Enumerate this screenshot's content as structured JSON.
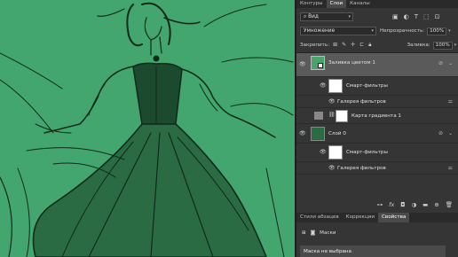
{
  "canvas": {
    "background": "#43a66e",
    "ink": "#0f2a1a"
  },
  "panel": {
    "tabs": [
      "Контуры",
      "Слои",
      "Каналы"
    ],
    "filter": {
      "value": "Вид"
    },
    "blend_mode": "Умножение",
    "opacity_label": "Непрозрачность:",
    "opacity_value": "100%",
    "lock_label": "Закрепить:",
    "fill_label": "Заливка:",
    "fill_value": "100%"
  },
  "layers": [
    {
      "name": "Заливка цветом 1",
      "type": "fill",
      "selected": true,
      "color": "#48a46c"
    },
    {
      "name": "Смарт-фильтры",
      "type": "smart-filters"
    },
    {
      "name": "Галерея фильтров",
      "type": "filter"
    },
    {
      "name": "Карта градиента 1",
      "type": "adjustment"
    },
    {
      "name": "Слой 0",
      "type": "smart-object"
    },
    {
      "name": "Смарт-фильтры",
      "type": "smart-filters"
    },
    {
      "name": "Галерея фильтров",
      "type": "filter"
    }
  ],
  "bottom_panel": {
    "tabs": [
      "Стили абзацев",
      "Коррекции",
      "Свойства"
    ],
    "mask_label": "Маски",
    "mask_status": "Маска не выбрана"
  }
}
